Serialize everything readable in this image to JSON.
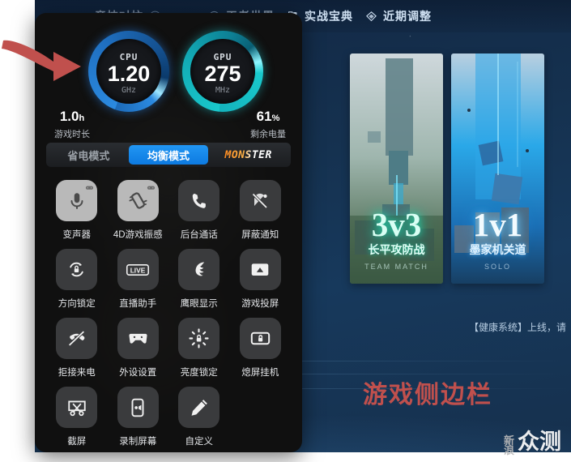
{
  "background": {
    "topnav": [
      {
        "id": "nav-competitive",
        "label": "竞技对抗",
        "icon": "help-circle-icon"
      },
      {
        "id": "nav-king-world",
        "label": "王者世界",
        "icon": "compass-icon"
      },
      {
        "id": "nav-battle-guide",
        "label": "实战宝典",
        "icon": "book-icon"
      },
      {
        "id": "nav-recent-adjust",
        "label": "近期调整",
        "icon": "diamond-icon"
      }
    ],
    "cards": [
      {
        "id": "card-3v3",
        "mode": "3v3",
        "title": "长平攻防战",
        "subtitle": "TEAM MATCH"
      },
      {
        "id": "card-1v1",
        "mode": "1v1",
        "title": "墨家机关道",
        "subtitle": "SOLO"
      }
    ],
    "health_notice": "【健康系统】上线，请"
  },
  "annotation": {
    "callout_label": "游戏侧边栏",
    "callout_color": "#c0504d",
    "arrow": "curved-right-arrow",
    "watermark_small_top": "新",
    "watermark_small_bottom": "浪",
    "watermark_big": "众测"
  },
  "sidebar": {
    "gauges": [
      {
        "id": "cpu",
        "label": "CPU",
        "value": "1.20",
        "unit": "GHz",
        "color": "#2b8ae0"
      },
      {
        "id": "gpu",
        "label": "GPU",
        "value": "275",
        "unit": "MHz",
        "color": "#19c9cc"
      }
    ],
    "stats": [
      {
        "id": "play-time",
        "value": "1.0",
        "unit": "h",
        "caption": "游戏时长"
      },
      {
        "id": "battery",
        "value": "61",
        "unit": "%",
        "caption": "剩余电量"
      }
    ],
    "modes": [
      {
        "id": "mode-power-save",
        "label": "省电模式",
        "active": false
      },
      {
        "id": "mode-balanced",
        "label": "均衡模式",
        "active": true
      },
      {
        "id": "mode-monster",
        "label": "MONSTER",
        "active": false
      }
    ],
    "grid": [
      [
        {
          "id": "voice-changer",
          "label": "变声器",
          "icon": "microphone-icon",
          "lit": true,
          "badge": "gamepad-badge-icon"
        },
        {
          "id": "vibration-4d",
          "label": "4D游戏振感",
          "icon": "phone-vibrate-icon",
          "lit": true,
          "badge": "gamepad-badge-icon"
        },
        {
          "id": "background-call",
          "label": "后台通话",
          "icon": "phone-call-icon",
          "lit": false,
          "badge": null
        },
        {
          "id": "block-notification",
          "label": "屏蔽通知",
          "icon": "notification-off-icon",
          "lit": false,
          "badge": null
        }
      ],
      [
        {
          "id": "orientation-lock",
          "label": "方向锁定",
          "icon": "rotation-lock-icon",
          "lit": false,
          "badge": null
        },
        {
          "id": "live-assistant",
          "label": "直播助手",
          "icon": "live-icon",
          "lit": false,
          "badge": null
        },
        {
          "id": "eagle-eye",
          "label": "鹰眼显示",
          "icon": "eagle-icon",
          "lit": false,
          "badge": null
        },
        {
          "id": "game-cast",
          "label": "游戏投屏",
          "icon": "screencast-icon",
          "lit": false,
          "badge": null
        }
      ],
      [
        {
          "id": "reject-call",
          "label": "拒接来电",
          "icon": "call-reject-icon",
          "lit": false,
          "badge": null
        },
        {
          "id": "peripheral-settings",
          "label": "外设设置",
          "icon": "gamepad-icon",
          "lit": false,
          "badge": null
        },
        {
          "id": "brightness-lock",
          "label": "亮度锁定",
          "icon": "brightness-lock-icon",
          "lit": false,
          "badge": null
        },
        {
          "id": "screen-off-standby",
          "label": "熄屏挂机",
          "icon": "screen-lock-icon",
          "lit": false,
          "badge": null
        }
      ],
      [
        {
          "id": "screenshot",
          "label": "截屏",
          "icon": "scissors-screenshot-icon",
          "lit": false,
          "badge": null
        },
        {
          "id": "screen-record",
          "label": "录制屏幕",
          "icon": "record-screen-icon",
          "lit": false,
          "badge": null
        },
        {
          "id": "customize",
          "label": "自定义",
          "icon": "pencil-icon",
          "lit": false,
          "badge": null
        }
      ]
    ]
  }
}
